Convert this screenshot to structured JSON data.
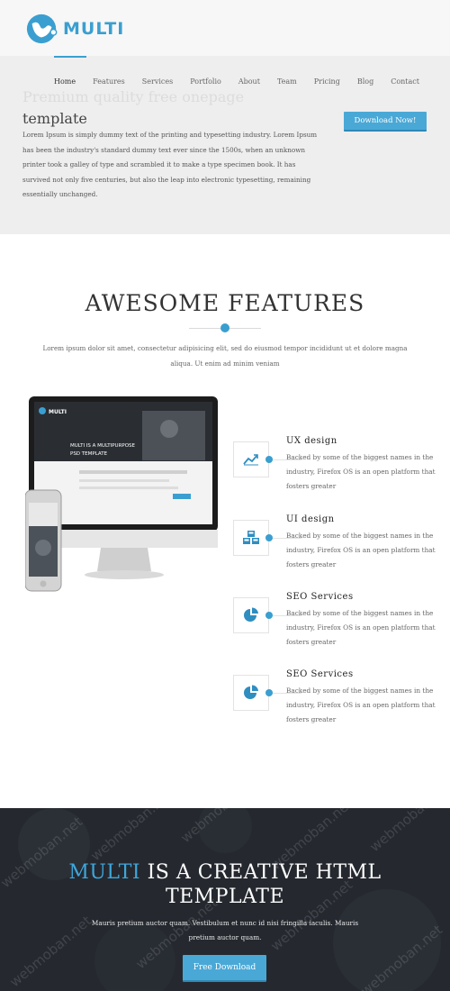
{
  "brand": {
    "name": "MULTI"
  },
  "nav": {
    "items": [
      "Home",
      "Features",
      "Services",
      "Portfolio",
      "About",
      "Team",
      "Pricing",
      "Blog",
      "Contact"
    ],
    "active": "Home"
  },
  "hero": {
    "title_faded": "Premium quality free onepage",
    "title": "template",
    "text": "Lorem Ipsum is simply dummy text of the printing and typesetting industry. Lorem Ipsum has been the industry's standard dummy text ever since the 1500s, when an unknown printer took a galley of type and scrambled it to make a type specimen book. It has survived not only five centuries, but also the leap into electronic typesetting, remaining essentially unchanged.",
    "button": "Download Now!"
  },
  "features": {
    "title": "AWESOME FEATURES",
    "subtitle": "Lorem ipsum dolor sit amet, consectetur adipisicing elit, sed do eiusmod tempor incididunt ut et dolore magna aliqua. Ut enim ad minim veniam",
    "items": [
      {
        "title": "UX design",
        "text": "Backed by some of the biggest names in the industry, Firefox OS is an open platform that fosters greater",
        "icon": "chart-icon"
      },
      {
        "title": "UI design",
        "text": "Backed by some of the biggest names in the industry, Firefox OS is an open platform that fosters greater",
        "icon": "cubes-icon"
      },
      {
        "title": "SEO Services",
        "text": "Backed by some of the biggest names in the industry, Firefox OS is an open platform that fosters greater",
        "icon": "pie-chart-icon"
      },
      {
        "title": "SEO Services",
        "text": "Backed by some of the biggest names in the industry, Firefox OS is an open platform that fosters greater",
        "icon": "pie-chart-icon"
      }
    ]
  },
  "device_screen": {
    "brand": "MULTI",
    "headline_1": "MULTI IS A MULTIPURPOSE",
    "headline_2": "PSD TEMPLATE"
  },
  "cta": {
    "title_accent": "MULTI",
    "title_rest": " IS A CREATIVE HTML TEMPLATE",
    "text": "Mauris pretium auctor quam. Vestibulum et nunc id nisi fringilla iaculis. Mauris pretium auctor quam.",
    "button": "Free Download"
  },
  "watermark": "webmoban.net",
  "colors": {
    "accent": "#3a9fd0",
    "dark_bg": "#25292f",
    "header_bg": "#eeeeee"
  }
}
